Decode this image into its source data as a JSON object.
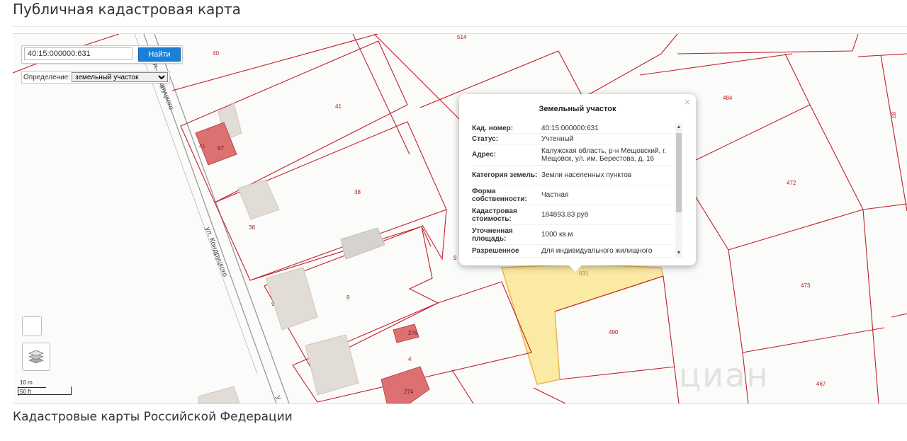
{
  "page": {
    "title": "Публичная кадастровая карта"
  },
  "search": {
    "value": "40:15:000000:631",
    "button_label": "Найти"
  },
  "definition": {
    "label": "Определение:",
    "selected": "земельный участок"
  },
  "popup": {
    "title": "Земельный участок",
    "close_symbol": "×",
    "rows": [
      {
        "key": "Кад. номер:",
        "value": "40:15:000000:631"
      },
      {
        "key": "Статус:",
        "value": "Учтенный"
      },
      {
        "key": "Адрес:",
        "value": "Калужская область, р-н Мещовский, г. Мещовск, ул. им. Берестова, д. 16"
      },
      {
        "key": "Категория земель:",
        "value": "Земли населенных пунктов"
      },
      {
        "key": "Форма собственности:",
        "value": "Частная"
      },
      {
        "key": "Кадастровая стоимость:",
        "value": "184893.83 руб"
      },
      {
        "key": "Уточненная площадь:",
        "value": "1000 кв.м"
      },
      {
        "key": "Разрешенное",
        "value": "Для индивидуального жилищного"
      }
    ]
  },
  "map": {
    "parcel_labels": [
      "514",
      "40",
      "41",
      "41",
      "97",
      "38",
      "38",
      "9",
      "9",
      "9",
      "276",
      "4",
      "274",
      "631",
      "484",
      "472",
      "473",
      "490",
      "467",
      "83"
    ],
    "street_labels": [
      "ул. Кондруцкого",
      "ул. Кондруцкого",
      "у"
    ],
    "highlight_color": "#fbeaa3",
    "boundary_color": "#c0202a",
    "building_color": "#dd7070"
  },
  "scale": {
    "top_label": "10 m",
    "bottom_label": "50 ft"
  },
  "watermark": "циан",
  "section": {
    "title": "Кадастровые карты Российской Федерации"
  },
  "icons": {
    "layers": "layers-icon",
    "close": "close-icon"
  }
}
